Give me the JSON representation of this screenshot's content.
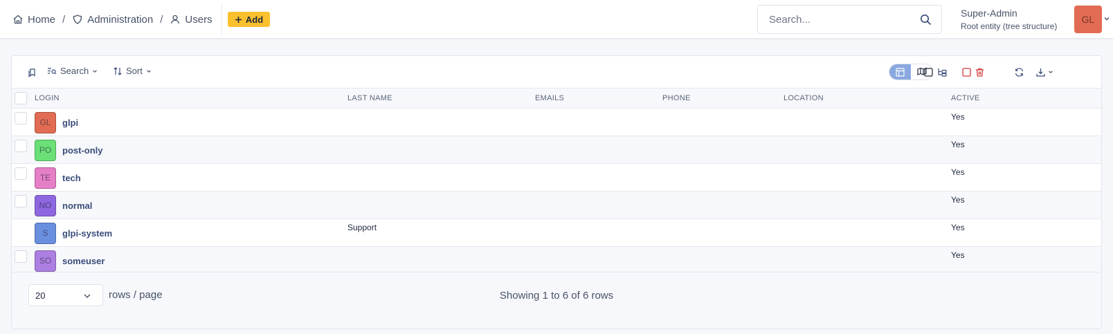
{
  "breadcrumb": {
    "home": "Home",
    "administration": "Administration",
    "users": "Users",
    "separator": "/"
  },
  "header": {
    "add_label": "Add",
    "search_placeholder": "Search...",
    "user_name": "Super-Admin",
    "user_entity": "Root entity (tree structure)",
    "user_initials": "GL",
    "user_avatar_color": "#e26c53"
  },
  "toolbar": {
    "search_label": "Search",
    "sort_label": "Sort"
  },
  "table": {
    "columns": [
      "LOGIN",
      "LAST NAME",
      "EMAILS",
      "PHONE",
      "LOCATION",
      "ACTIVE"
    ],
    "rows": [
      {
        "initials": "GL",
        "color": "#e26c53",
        "login": "glpi",
        "last_name": "",
        "emails": "",
        "phone": "",
        "location": "",
        "active": "Yes"
      },
      {
        "initials": "PO",
        "color": "#6ae076",
        "login": "post-only",
        "last_name": "",
        "emails": "",
        "phone": "",
        "location": "",
        "active": "Yes"
      },
      {
        "initials": "TE",
        "color": "#e57fc6",
        "login": "tech",
        "last_name": "",
        "emails": "",
        "phone": "",
        "location": "",
        "active": "Yes"
      },
      {
        "initials": "NO",
        "color": "#8e67e0",
        "login": "normal",
        "last_name": "",
        "emails": "",
        "phone": "",
        "location": "",
        "active": "Yes"
      },
      {
        "initials": "S",
        "color": "#6b8fdf",
        "login": "glpi-system",
        "last_name": "Support",
        "emails": "",
        "phone": "",
        "location": "",
        "active": "Yes"
      },
      {
        "initials": "SO",
        "color": "#ad7fe2",
        "login": "someuser",
        "last_name": "",
        "emails": "",
        "phone": "",
        "location": "",
        "active": "Yes"
      }
    ]
  },
  "footer": {
    "rows_per_page": "20",
    "rows_label": "rows / page",
    "showing": "Showing 1 to 6 of 6 rows"
  },
  "colors": {
    "accent_yellow": "#fbc02d",
    "danger_red": "#d63939",
    "toggle_active": "#8aa8e0"
  }
}
